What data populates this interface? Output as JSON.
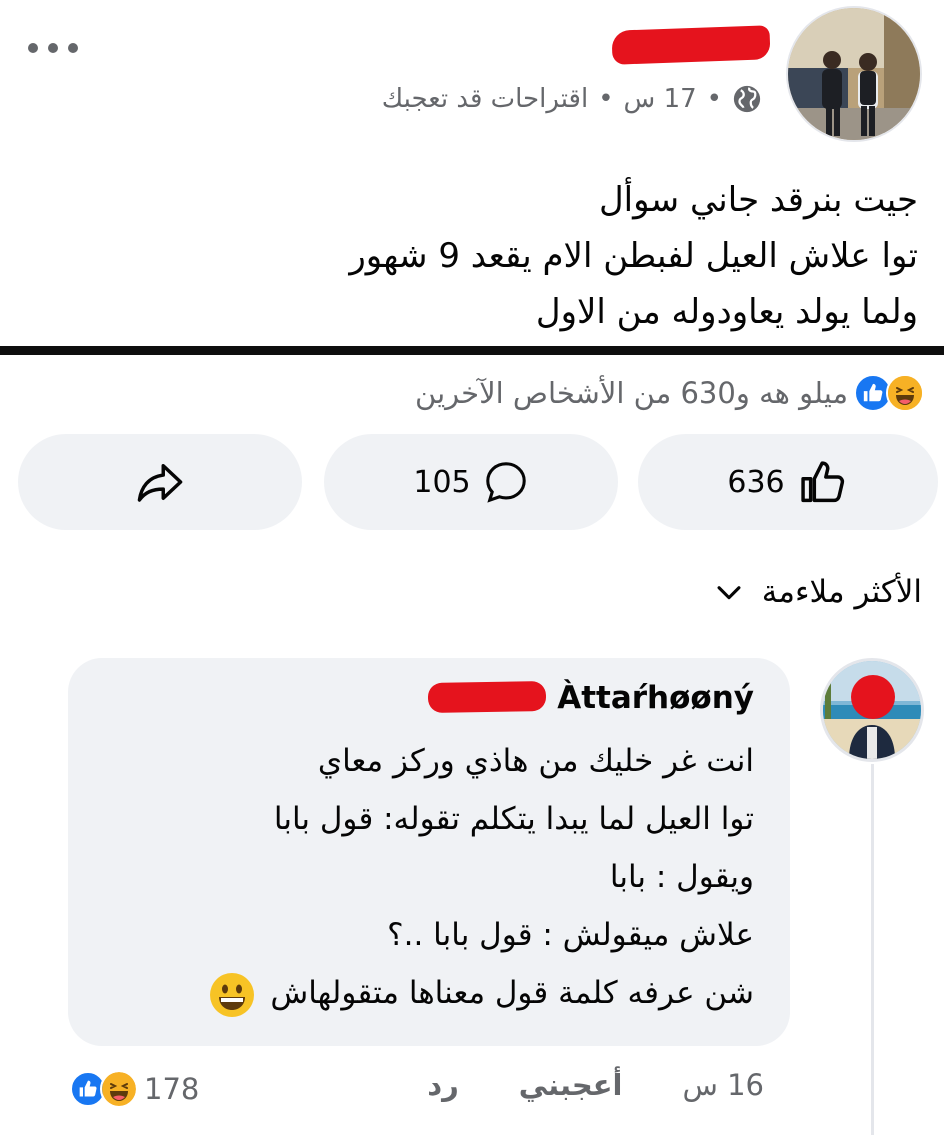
{
  "post": {
    "time": "17 س",
    "suggestion": "اقتراحات قد تعجبك",
    "separator": "•",
    "lines": [
      "جيت بنرقد جاني سوأل",
      "توا علاش العيل لفبطن الام يقعد 9 شهور",
      "ولما يولد يعاودوله من الاول"
    ]
  },
  "reactions": {
    "summary": "ميلو هه و630 من الأشخاص الآخرين",
    "like_count": "636",
    "comment_count": "105"
  },
  "sort": {
    "label": "الأكثر ملاءمة"
  },
  "comment": {
    "author": "Àttaŕhøøný",
    "lines": [
      "انت غر خليك من هاذي وركز معاي",
      "توا العيل لما يبدا يتكلم تقوله: قول بابا",
      "ويقول : بابا",
      "علاش ميقولش : قول بابا ..؟",
      "شن عرفه كلمة قول معناها متقولهاش"
    ],
    "time": "16 س",
    "like_label": "أعجبني",
    "reply_label": "رد",
    "reaction_count": "178"
  },
  "colors": {
    "accent": "#1877f2",
    "muted": "#65676b",
    "bubble": "#f0f2f5",
    "redaction": "#e5131d"
  }
}
